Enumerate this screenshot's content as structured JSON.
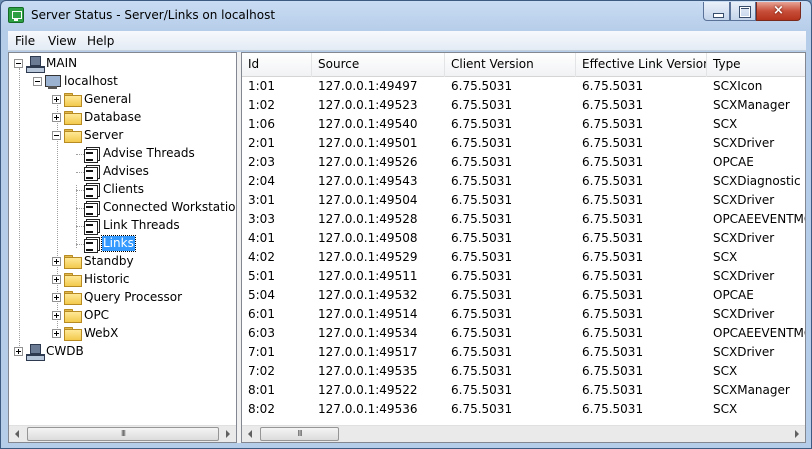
{
  "window": {
    "title": "Server Status - Server/Links on localhost",
    "close_glyph": "×"
  },
  "menu": [
    "File",
    "View",
    "Help"
  ],
  "tree": {
    "nodes": [
      {
        "label": "MAIN",
        "icon": "network-server-icon",
        "depth": 0,
        "expander": "minus"
      },
      {
        "label": "localhost",
        "icon": "host-computer-icon",
        "depth": 1,
        "expander": "minus"
      },
      {
        "label": "General",
        "icon": "folder-icon",
        "depth": 2,
        "expander": "plus"
      },
      {
        "label": "Database",
        "icon": "folder-icon",
        "depth": 2,
        "expander": "plus"
      },
      {
        "label": "Server",
        "icon": "folder-icon",
        "depth": 2,
        "expander": "minus"
      },
      {
        "label": "Advise Threads",
        "icon": "document-icon",
        "depth": 3,
        "expander": "none"
      },
      {
        "label": "Advises",
        "icon": "document-icon",
        "depth": 3,
        "expander": "none"
      },
      {
        "label": "Clients",
        "icon": "document-icon",
        "depth": 3,
        "expander": "none"
      },
      {
        "label": "Connected Workstation",
        "icon": "document-icon",
        "depth": 3,
        "expander": "none"
      },
      {
        "label": "Link Threads",
        "icon": "document-icon",
        "depth": 3,
        "expander": "none"
      },
      {
        "label": "Links",
        "icon": "document-icon",
        "depth": 3,
        "expander": "none",
        "selected": true
      },
      {
        "label": "Standby",
        "icon": "folder-icon",
        "depth": 2,
        "expander": "plus"
      },
      {
        "label": "Historic",
        "icon": "folder-icon",
        "depth": 2,
        "expander": "plus"
      },
      {
        "label": "Query Processor",
        "icon": "folder-icon",
        "depth": 2,
        "expander": "plus"
      },
      {
        "label": "OPC",
        "icon": "folder-icon",
        "depth": 2,
        "expander": "plus"
      },
      {
        "label": "WebX",
        "icon": "folder-icon",
        "depth": 2,
        "expander": "plus"
      },
      {
        "label": "CWDB",
        "icon": "network-server-icon",
        "depth": 0,
        "expander": "plus"
      }
    ]
  },
  "list": {
    "columns": [
      "Id",
      "Source",
      "Client Version",
      "Effective Link Version",
      "Type"
    ],
    "rows": [
      [
        "1:01",
        "127.0.0.1:49497",
        "6.75.5031",
        "6.75.5031",
        "SCXIcon"
      ],
      [
        "1:02",
        "127.0.0.1:49523",
        "6.75.5031",
        "6.75.5031",
        "SCXManager"
      ],
      [
        "1:06",
        "127.0.0.1:49540",
        "6.75.5031",
        "6.75.5031",
        "SCX"
      ],
      [
        "2:01",
        "127.0.0.1:49501",
        "6.75.5031",
        "6.75.5031",
        "SCXDriver"
      ],
      [
        "2:03",
        "127.0.0.1:49526",
        "6.75.5031",
        "6.75.5031",
        "OPCAE"
      ],
      [
        "2:04",
        "127.0.0.1:49543",
        "6.75.5031",
        "6.75.5031",
        "SCXDiagnostic"
      ],
      [
        "3:01",
        "127.0.0.1:49504",
        "6.75.5031",
        "6.75.5031",
        "SCXDriver"
      ],
      [
        "3:03",
        "127.0.0.1:49528",
        "6.75.5031",
        "6.75.5031",
        "OPCAEEVENTMO"
      ],
      [
        "4:01",
        "127.0.0.1:49508",
        "6.75.5031",
        "6.75.5031",
        "SCXDriver"
      ],
      [
        "4:02",
        "127.0.0.1:49529",
        "6.75.5031",
        "6.75.5031",
        "SCX"
      ],
      [
        "5:01",
        "127.0.0.1:49511",
        "6.75.5031",
        "6.75.5031",
        "SCXDriver"
      ],
      [
        "5:04",
        "127.0.0.1:49532",
        "6.75.5031",
        "6.75.5031",
        "OPCAE"
      ],
      [
        "6:01",
        "127.0.0.1:49514",
        "6.75.5031",
        "6.75.5031",
        "SCXDriver"
      ],
      [
        "6:03",
        "127.0.0.1:49534",
        "6.75.5031",
        "6.75.5031",
        "OPCAEEVENTMO"
      ],
      [
        "7:01",
        "127.0.0.1:49517",
        "6.75.5031",
        "6.75.5031",
        "SCXDriver"
      ],
      [
        "7:02",
        "127.0.0.1:49535",
        "6.75.5031",
        "6.75.5031",
        "SCX"
      ],
      [
        "8:01",
        "127.0.0.1:49522",
        "6.75.5031",
        "6.75.5031",
        "SCXManager"
      ],
      [
        "8:02",
        "127.0.0.1:49536",
        "6.75.5031",
        "6.75.5031",
        "SCX"
      ]
    ]
  }
}
